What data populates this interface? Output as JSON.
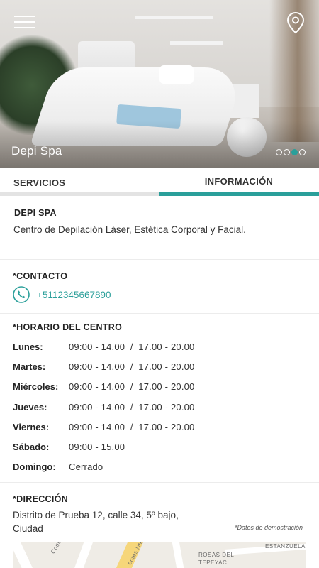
{
  "hero": {
    "title": "Depi Spa",
    "slides": [
      {
        "active": false
      },
      {
        "active": false
      },
      {
        "active": true
      },
      {
        "active": false
      }
    ]
  },
  "tabs": [
    {
      "label": "SERVICIOS",
      "active": false
    },
    {
      "label": "INFORMACIÓN",
      "active": true
    }
  ],
  "about": {
    "title": "DEPI SPA",
    "description": "Centro de Depilación Láser, Estética Corporal y Facial."
  },
  "contact": {
    "title": "*CONTACTO",
    "phone": "+5112345667890"
  },
  "schedule": {
    "title": "*HORARIO DEL CENTRO",
    "rows": [
      {
        "day": "Lunes:",
        "hours": "09:00 - 14.00  /  17.00 - 20.00"
      },
      {
        "day": "Martes:",
        "hours": "09:00 - 14.00  /  17.00 - 20.00"
      },
      {
        "day": "Miércoles:",
        "hours": "09:00 - 14.00  /  17.00 - 20.00"
      },
      {
        "day": "Jueves:",
        "hours": "09:00 - 14.00  /  17.00 - 20.00"
      },
      {
        "day": "Viernes:",
        "hours": "09:00 - 14.00  /  17.00 - 20.00"
      },
      {
        "day": "Sábado:",
        "hours": "09:00 - 15.00"
      },
      {
        "day": "Domingo:",
        "hours": "Cerrado"
      }
    ]
  },
  "address": {
    "title": "*DIRECCIÓN",
    "line1": "Distrito de Prueba 12, calle 34, 5º bajo,",
    "line2": "Ciudad",
    "note": "*Datos de demostración"
  },
  "map": {
    "labels": [
      "Coquimbo",
      "ESTANZUELA",
      "ROSAS DEL",
      "TEPEYAC",
      "entes Nte"
    ]
  },
  "colors": {
    "accent": "#2a9f9a"
  },
  "icons": {
    "menu": "hamburger-menu-icon",
    "location": "map-pin-icon",
    "phone": "phone-icon"
  }
}
